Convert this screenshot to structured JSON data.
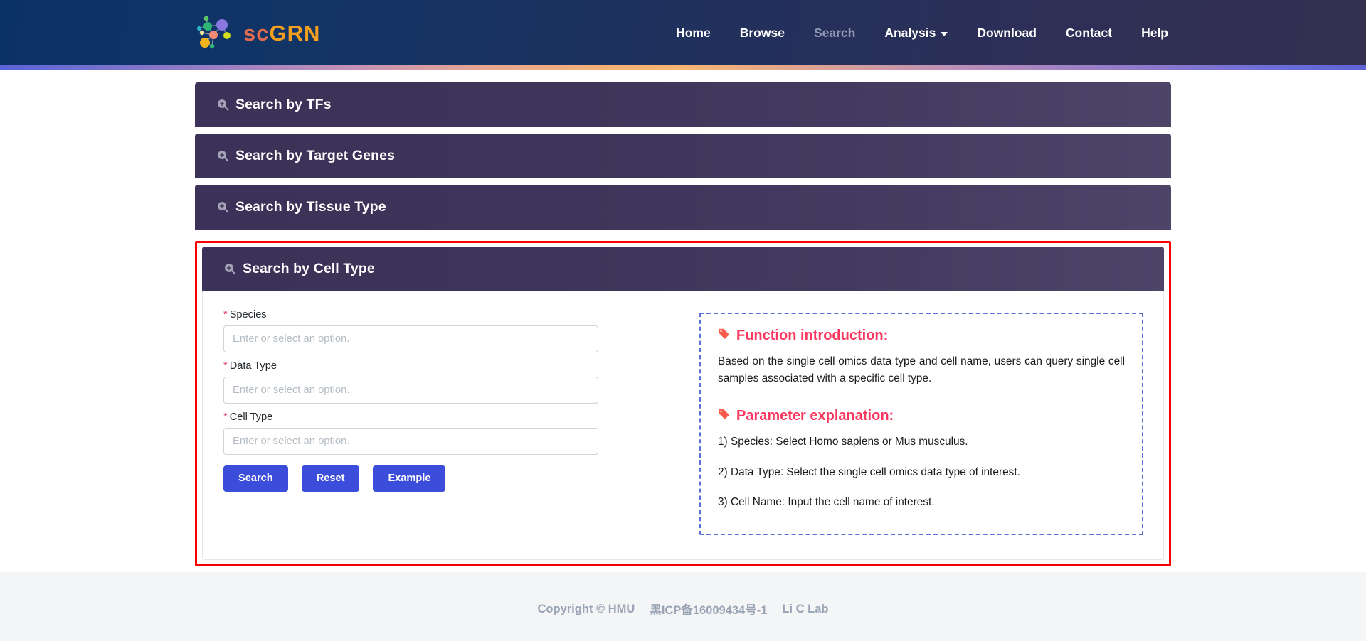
{
  "header": {
    "brand": {
      "prefix": "sc",
      "suffix": "GRN",
      "logo_icon": "molecule-network-icon"
    },
    "nav": [
      {
        "label": "Home",
        "state": "normal",
        "icon": null
      },
      {
        "label": "Browse",
        "state": "normal",
        "icon": null
      },
      {
        "label": "Search",
        "state": "active-muted",
        "icon": null
      },
      {
        "label": "Analysis",
        "state": "normal",
        "icon": "chevron-down-icon"
      },
      {
        "label": "Download",
        "state": "normal",
        "icon": null
      },
      {
        "label": "Contact",
        "state": "normal",
        "icon": null
      },
      {
        "label": "Help",
        "state": "normal",
        "icon": null
      }
    ]
  },
  "accordion": {
    "panel_icon": "zoom-in-magnifier-icon",
    "items": [
      {
        "title": "Search by TFs",
        "expanded": false
      },
      {
        "title": "Search by Target Genes",
        "expanded": false
      },
      {
        "title": "Search by Tissue Type",
        "expanded": false
      },
      {
        "title": "Search by Cell Type",
        "expanded": true
      }
    ]
  },
  "form": {
    "fields": [
      {
        "label": "Species",
        "required_marker": "*",
        "value": "",
        "placeholder": "Enter or select an option."
      },
      {
        "label": "Data Type",
        "required_marker": "*",
        "value": "",
        "placeholder": "Enter or select an option."
      },
      {
        "label": "Cell Type",
        "required_marker": "*",
        "value": "",
        "placeholder": "Enter or select an option."
      }
    ],
    "buttons": [
      {
        "label": "Search"
      },
      {
        "label": "Reset"
      },
      {
        "label": "Example"
      }
    ]
  },
  "info": {
    "tag_icon": "tag-icon",
    "function_heading": "Function introduction:",
    "function_text": "Based on the single cell omics data type and cell name, users can query single cell samples associated with a specific cell type.",
    "parameter_heading": "Parameter explanation:",
    "parameters": [
      "1) Species: Select Homo sapiens or Mus musculus.",
      "2) Data Type: Select the single cell omics data type of interest.",
      "3) Cell Name: Input the cell name of interest."
    ]
  },
  "footer": {
    "copyright": "Copyright © HMU",
    "icp": "黑ICP备16009434号-1",
    "lab": "Li C Lab"
  },
  "colors": {
    "header_start": "#0b3169",
    "header_end": "#343150",
    "panel_header": "#3c3158",
    "button_blue": "#3d4ddb",
    "accent_red": "#f9375f",
    "highlight_red": "#fb0000",
    "dashed_blue": "#5b6fd8",
    "required_star": "#e4345c",
    "footer_text": "#9aa4b5",
    "brand_sc": "#e26a4e",
    "brand_grn": "#f4a01e"
  }
}
